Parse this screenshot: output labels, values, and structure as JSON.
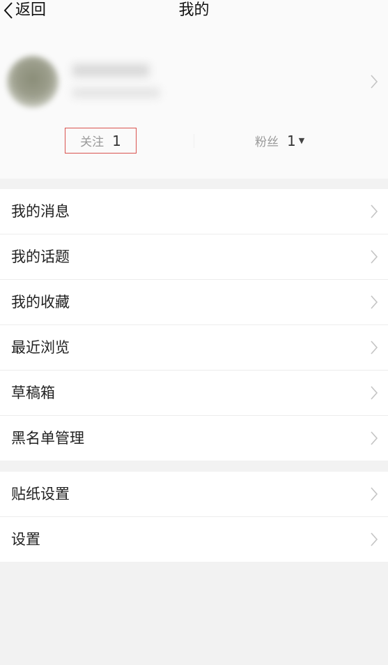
{
  "topbar": {
    "back_label": "返回",
    "title": "我的"
  },
  "profile": {
    "follow_label": "关注",
    "follow_count": "1",
    "fans_label": "粉丝",
    "fans_count": "1"
  },
  "menu_group_1": [
    {
      "label": "我的消息"
    },
    {
      "label": "我的话题"
    },
    {
      "label": "我的收藏"
    },
    {
      "label": "最近浏览"
    },
    {
      "label": "草稿箱"
    },
    {
      "label": "黑名单管理"
    }
  ],
  "menu_group_2": [
    {
      "label": "贴纸设置"
    },
    {
      "label": "设置"
    }
  ],
  "colors": {
    "highlight_border": "#d9534f",
    "page_background": "#f2f2f2"
  }
}
